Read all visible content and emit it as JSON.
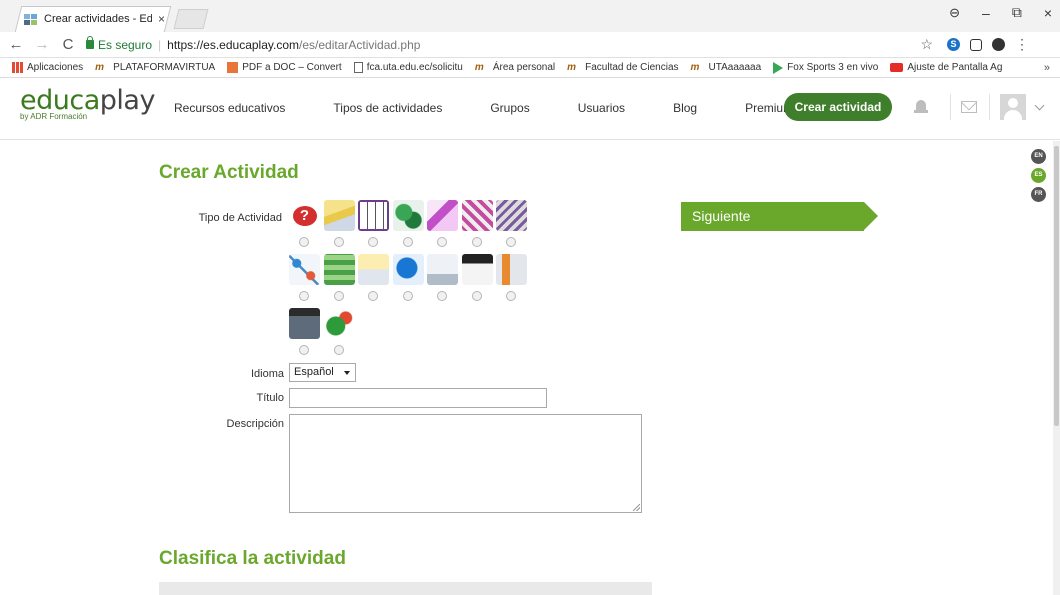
{
  "browser": {
    "tab_title": "Crear actividades - Educa",
    "tab_close": "×",
    "window_controls": {
      "profile": "⊖",
      "minimize": "–",
      "maximize": "⧉",
      "close": "×"
    },
    "nav": {
      "back": "←",
      "forward": "→",
      "reload": "C"
    },
    "security_label": "Es seguro",
    "url_host": "https://es.educaplay.com",
    "url_path": "/es/editarActividad.php",
    "star": "☆",
    "ext_s": "S",
    "menu": "⋮",
    "bookmarks": [
      {
        "label": "Aplicaciones",
        "icon": "apps-icon"
      },
      {
        "label": "PLATAFORMAVIRTUA",
        "icon": "tm-icon"
      },
      {
        "label": "PDF a DOC – Convert",
        "icon": "pdf-icon"
      },
      {
        "label": "fca.uta.edu.ec/solicitu",
        "icon": "doc-icon"
      },
      {
        "label": "Área personal",
        "icon": "tm-icon"
      },
      {
        "label": "Facultad de Ciencias",
        "icon": "tm-icon"
      },
      {
        "label": "UTAaaaaaa",
        "icon": "tm-icon"
      },
      {
        "label": "Fox Sports 3 en vivo",
        "icon": "play-icon"
      },
      {
        "label": "Ajuste de Pantalla Ag",
        "icon": "youtube-icon"
      }
    ],
    "bookmarks_more": "»"
  },
  "site": {
    "logo_edu": "educa",
    "logo_play": "play",
    "logo_sub": "by ADR Formación",
    "nav": [
      "Recursos educativos",
      "Tipos de actividades",
      "Grupos",
      "Usuarios",
      "Blog",
      "Premium"
    ],
    "cta": "Crear actividad",
    "languages": [
      "EN",
      "ES",
      "FR"
    ],
    "active_language": "ES"
  },
  "form": {
    "heading": "Crear Actividad",
    "tipo_label": "Tipo de Actividad",
    "idioma_label": "Idioma",
    "idioma_value": "Español",
    "titulo_label": "Título",
    "descripcion_label": "Descripción",
    "next_button": "Siguiente",
    "classify_heading": "Clasifica la actividad",
    "activity_types": [
      "quiz-question-icon",
      "fill-blanks-icon",
      "crossword-icon",
      "puzzle-pieces-icon",
      "writing-pen-icon",
      "word-search-icon",
      "word-scramble-icon",
      "relate-columns-icon",
      "letter-soup-icon",
      "numbered-list-icon",
      "world-map-icon",
      "presentation-icon",
      "video-quiz-icon",
      "diagram-icon",
      "photo-folder-icon",
      "abc-dialogue-icon"
    ]
  }
}
